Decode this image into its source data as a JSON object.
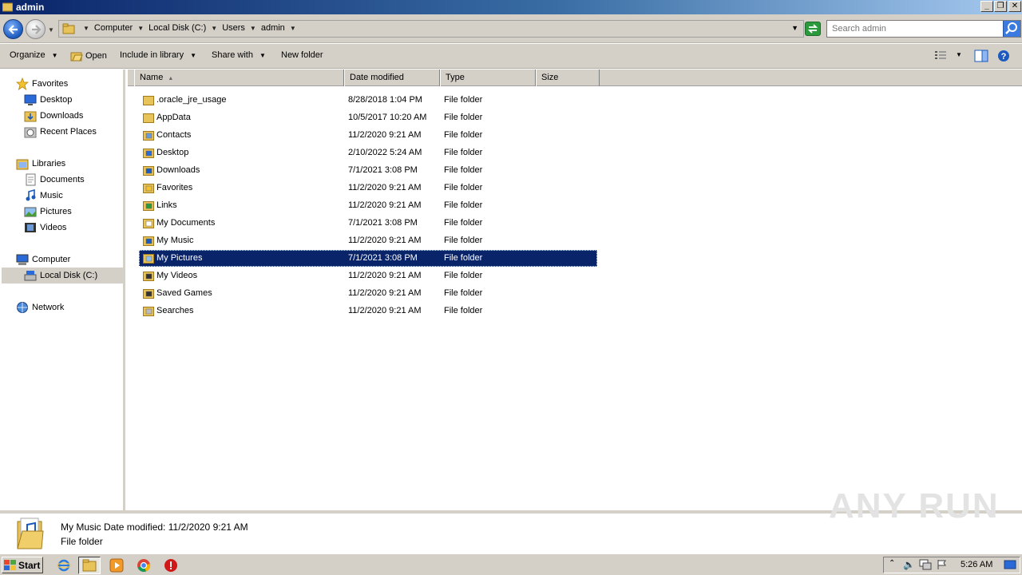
{
  "window": {
    "title": "admin"
  },
  "address": {
    "crumbs": [
      "Computer",
      "Local Disk (C:)",
      "Users",
      "admin"
    ]
  },
  "search": {
    "placeholder": "Search admin"
  },
  "toolbar": {
    "organize": "Organize",
    "open": "Open",
    "include_in_library": "Include in library",
    "share_with": "Share with",
    "new_folder": "New folder"
  },
  "nav": {
    "favorites": {
      "label": "Favorites",
      "items": [
        "Desktop",
        "Downloads",
        "Recent Places"
      ]
    },
    "libraries": {
      "label": "Libraries",
      "items": [
        "Documents",
        "Music",
        "Pictures",
        "Videos"
      ]
    },
    "computer": {
      "label": "Computer",
      "items": [
        "Local Disk (C:)"
      ]
    },
    "network": {
      "label": "Network"
    }
  },
  "columns": {
    "name": "Name",
    "date_modified": "Date modified",
    "type": "Type",
    "size": "Size"
  },
  "files": [
    {
      "name": ".oracle_jre_usage",
      "date": "8/28/2018 1:04 PM",
      "type": "File folder",
      "icon": "folder-icon"
    },
    {
      "name": "AppData",
      "date": "10/5/2017 10:20 AM",
      "type": "File folder",
      "icon": "folder-icon"
    },
    {
      "name": "Contacts",
      "date": "11/2/2020 9:21 AM",
      "type": "File folder",
      "icon": "contacts-folder-icon"
    },
    {
      "name": "Desktop",
      "date": "2/10/2022 5:24 AM",
      "type": "File folder",
      "icon": "desktop-folder-icon"
    },
    {
      "name": "Downloads",
      "date": "7/1/2021 3:08 PM",
      "type": "File folder",
      "icon": "downloads-folder-icon"
    },
    {
      "name": "Favorites",
      "date": "11/2/2020 9:21 AM",
      "type": "File folder",
      "icon": "favorites-folder-icon"
    },
    {
      "name": "Links",
      "date": "11/2/2020 9:21 AM",
      "type": "File folder",
      "icon": "links-folder-icon"
    },
    {
      "name": "My Documents",
      "date": "7/1/2021 3:08 PM",
      "type": "File folder",
      "icon": "documents-folder-icon"
    },
    {
      "name": "My Music",
      "date": "11/2/2020 9:21 AM",
      "type": "File folder",
      "icon": "music-folder-icon"
    },
    {
      "name": "My Pictures",
      "date": "7/1/2021 3:08 PM",
      "type": "File folder",
      "icon": "pictures-folder-icon",
      "selected": true
    },
    {
      "name": "My Videos",
      "date": "11/2/2020 9:21 AM",
      "type": "File folder",
      "icon": "videos-folder-icon"
    },
    {
      "name": "Saved Games",
      "date": "11/2/2020 9:21 AM",
      "type": "File folder",
      "icon": "saved-games-folder-icon"
    },
    {
      "name": "Searches",
      "date": "11/2/2020 9:21 AM",
      "type": "File folder",
      "icon": "searches-folder-icon"
    }
  ],
  "details": {
    "title": "My Music",
    "date_label": "Date modified:",
    "date": "11/2/2020 9:21 AM",
    "type": "File folder"
  },
  "watermark": "ANY RUN",
  "taskbar": {
    "start": "Start",
    "clock": "5:26 AM"
  },
  "colors": {
    "selection": "#0a246a",
    "chrome": "#d4d0c8",
    "folder": "#e8c35a"
  }
}
